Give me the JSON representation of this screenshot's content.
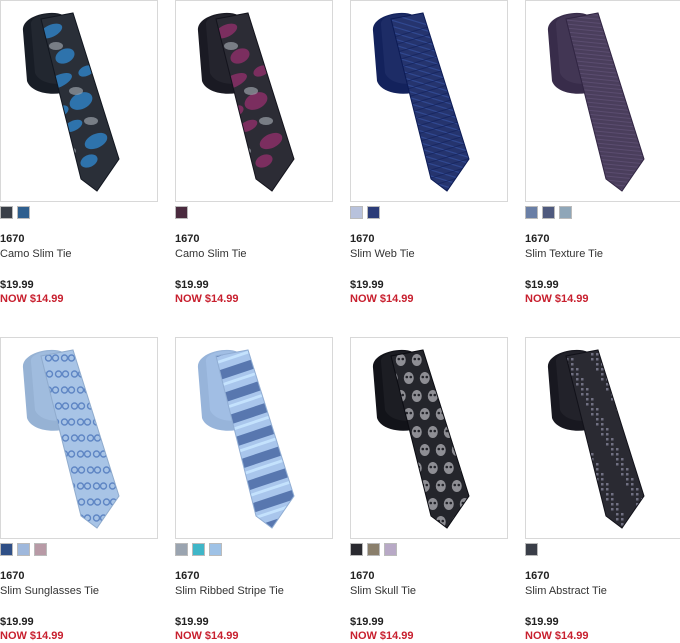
{
  "products": [
    {
      "brand": "1670",
      "name": "Camo Slim Tie",
      "original_price": "$19.99",
      "sale_label": "NOW",
      "sale_price": "$14.99",
      "swatches": [
        "#3a3f48",
        "#2f5f8e"
      ],
      "tie": {
        "base": "#2a2f38",
        "accent": "#2f7fc1",
        "pattern": "camo"
      }
    },
    {
      "brand": "1670",
      "name": "Camo Slim Tie",
      "original_price": "$19.99",
      "sale_label": "NOW",
      "sale_price": "$14.99",
      "swatches": [
        "#4a2a3e"
      ],
      "tie": {
        "base": "#2c2c35",
        "accent": "#8a2f66",
        "pattern": "camo"
      }
    },
    {
      "brand": "1670",
      "name": "Slim Web Tie",
      "original_price": "$19.99",
      "sale_label": "NOW",
      "sale_price": "$14.99",
      "swatches": [
        "#b8c2dc",
        "#2c3c78"
      ],
      "tie": {
        "base": "#25346e",
        "accent": "#3a57a8",
        "pattern": "web"
      }
    },
    {
      "brand": "1670",
      "name": "Slim Texture Tie",
      "original_price": "$19.99",
      "sale_label": "NOW",
      "sale_price": "$14.99",
      "swatches": [
        "#6a7fa6",
        "#4f5a7e",
        "#8fa6b8"
      ],
      "tie": {
        "base": "#4a3e5c",
        "accent": "#6b5a82",
        "pattern": "texture"
      }
    },
    {
      "brand": "1670",
      "name": "Slim Sunglasses Tie",
      "original_price": "$19.99",
      "sale_label": "NOW",
      "sale_price": "$14.99",
      "swatches": [
        "#2f4f86",
        "#9fb8dc",
        "#b89aa6"
      ],
      "tie": {
        "base": "#a8c4e6",
        "accent": "#5f86c4",
        "pattern": "sunglasses"
      }
    },
    {
      "brand": "1670",
      "name": "Slim Ribbed Stripe Tie",
      "original_price": "$19.99",
      "sale_label": "NOW",
      "sale_price": "$14.99",
      "swatches": [
        "#9aa4b0",
        "#3fb6c8",
        "#9fc2e6"
      ],
      "tie": {
        "base": "#a9c6ec",
        "accent": "#4f6ea8",
        "pattern": "stripe"
      }
    },
    {
      "brand": "1670",
      "name": "Slim Skull Tie",
      "original_price": "$19.99",
      "sale_label": "NOW",
      "sale_price": "$14.99",
      "swatches": [
        "#2a2a30",
        "#8a7f6c",
        "#b8a9c6"
      ],
      "tie": {
        "base": "#24252b",
        "accent": "#9a9aa0",
        "pattern": "skull"
      }
    },
    {
      "brand": "1670",
      "name": "Slim Abstract Tie",
      "original_price": "$19.99",
      "sale_label": "NOW",
      "sale_price": "$14.99",
      "swatches": [
        "#3a3e48"
      ],
      "tie": {
        "base": "#2a2a32",
        "accent": "#7c7c90",
        "pattern": "abstract"
      }
    }
  ]
}
